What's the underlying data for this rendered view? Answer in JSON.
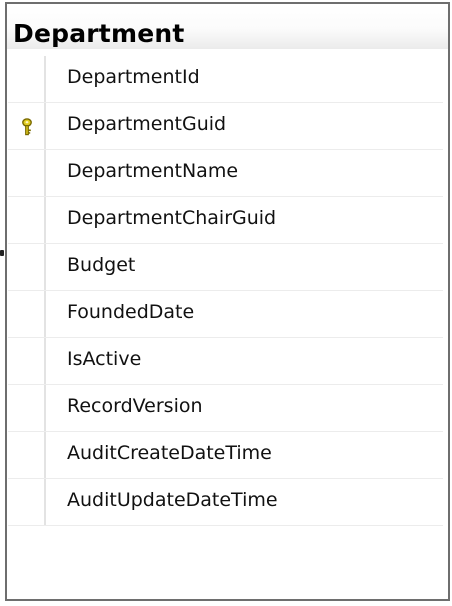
{
  "table": {
    "title": "Department",
    "columns": [
      {
        "name": "DepartmentId",
        "primary_key": false
      },
      {
        "name": "DepartmentGuid",
        "primary_key": true
      },
      {
        "name": "DepartmentName",
        "primary_key": false
      },
      {
        "name": "DepartmentChairGuid",
        "primary_key": false
      },
      {
        "name": "Budget",
        "primary_key": false
      },
      {
        "name": "FoundedDate",
        "primary_key": false
      },
      {
        "name": "IsActive",
        "primary_key": false
      },
      {
        "name": "RecordVersion",
        "primary_key": false
      },
      {
        "name": "AuditCreateDateTime",
        "primary_key": false
      },
      {
        "name": "AuditUpdateDateTime",
        "primary_key": false
      }
    ]
  },
  "icons": {
    "primary_key": "key-icon"
  },
  "colors": {
    "border": "#6e6e6e",
    "key_icon": "#d8c21a"
  }
}
